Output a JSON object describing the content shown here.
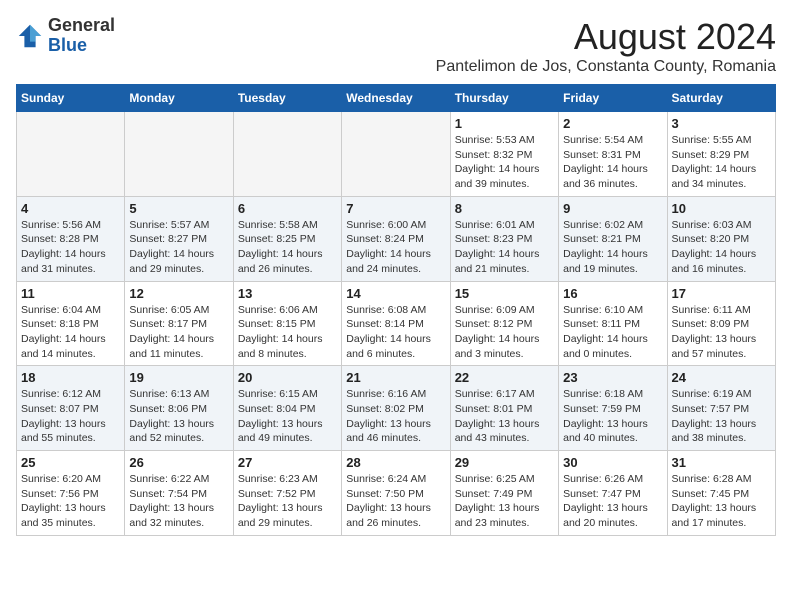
{
  "header": {
    "logo_general": "General",
    "logo_blue": "Blue",
    "month_year": "August 2024",
    "location": "Pantelimon de Jos, Constanta County, Romania"
  },
  "days_of_week": [
    "Sunday",
    "Monday",
    "Tuesday",
    "Wednesday",
    "Thursday",
    "Friday",
    "Saturday"
  ],
  "weeks": [
    {
      "alt": false,
      "days": [
        {
          "num": "",
          "info": ""
        },
        {
          "num": "",
          "info": ""
        },
        {
          "num": "",
          "info": ""
        },
        {
          "num": "",
          "info": ""
        },
        {
          "num": "1",
          "info": "Sunrise: 5:53 AM\nSunset: 8:32 PM\nDaylight: 14 hours\nand 39 minutes."
        },
        {
          "num": "2",
          "info": "Sunrise: 5:54 AM\nSunset: 8:31 PM\nDaylight: 14 hours\nand 36 minutes."
        },
        {
          "num": "3",
          "info": "Sunrise: 5:55 AM\nSunset: 8:29 PM\nDaylight: 14 hours\nand 34 minutes."
        }
      ]
    },
    {
      "alt": true,
      "days": [
        {
          "num": "4",
          "info": "Sunrise: 5:56 AM\nSunset: 8:28 PM\nDaylight: 14 hours\nand 31 minutes."
        },
        {
          "num": "5",
          "info": "Sunrise: 5:57 AM\nSunset: 8:27 PM\nDaylight: 14 hours\nand 29 minutes."
        },
        {
          "num": "6",
          "info": "Sunrise: 5:58 AM\nSunset: 8:25 PM\nDaylight: 14 hours\nand 26 minutes."
        },
        {
          "num": "7",
          "info": "Sunrise: 6:00 AM\nSunset: 8:24 PM\nDaylight: 14 hours\nand 24 minutes."
        },
        {
          "num": "8",
          "info": "Sunrise: 6:01 AM\nSunset: 8:23 PM\nDaylight: 14 hours\nand 21 minutes."
        },
        {
          "num": "9",
          "info": "Sunrise: 6:02 AM\nSunset: 8:21 PM\nDaylight: 14 hours\nand 19 minutes."
        },
        {
          "num": "10",
          "info": "Sunrise: 6:03 AM\nSunset: 8:20 PM\nDaylight: 14 hours\nand 16 minutes."
        }
      ]
    },
    {
      "alt": false,
      "days": [
        {
          "num": "11",
          "info": "Sunrise: 6:04 AM\nSunset: 8:18 PM\nDaylight: 14 hours\nand 14 minutes."
        },
        {
          "num": "12",
          "info": "Sunrise: 6:05 AM\nSunset: 8:17 PM\nDaylight: 14 hours\nand 11 minutes."
        },
        {
          "num": "13",
          "info": "Sunrise: 6:06 AM\nSunset: 8:15 PM\nDaylight: 14 hours\nand 8 minutes."
        },
        {
          "num": "14",
          "info": "Sunrise: 6:08 AM\nSunset: 8:14 PM\nDaylight: 14 hours\nand 6 minutes."
        },
        {
          "num": "15",
          "info": "Sunrise: 6:09 AM\nSunset: 8:12 PM\nDaylight: 14 hours\nand 3 minutes."
        },
        {
          "num": "16",
          "info": "Sunrise: 6:10 AM\nSunset: 8:11 PM\nDaylight: 14 hours\nand 0 minutes."
        },
        {
          "num": "17",
          "info": "Sunrise: 6:11 AM\nSunset: 8:09 PM\nDaylight: 13 hours\nand 57 minutes."
        }
      ]
    },
    {
      "alt": true,
      "days": [
        {
          "num": "18",
          "info": "Sunrise: 6:12 AM\nSunset: 8:07 PM\nDaylight: 13 hours\nand 55 minutes."
        },
        {
          "num": "19",
          "info": "Sunrise: 6:13 AM\nSunset: 8:06 PM\nDaylight: 13 hours\nand 52 minutes."
        },
        {
          "num": "20",
          "info": "Sunrise: 6:15 AM\nSunset: 8:04 PM\nDaylight: 13 hours\nand 49 minutes."
        },
        {
          "num": "21",
          "info": "Sunrise: 6:16 AM\nSunset: 8:02 PM\nDaylight: 13 hours\nand 46 minutes."
        },
        {
          "num": "22",
          "info": "Sunrise: 6:17 AM\nSunset: 8:01 PM\nDaylight: 13 hours\nand 43 minutes."
        },
        {
          "num": "23",
          "info": "Sunrise: 6:18 AM\nSunset: 7:59 PM\nDaylight: 13 hours\nand 40 minutes."
        },
        {
          "num": "24",
          "info": "Sunrise: 6:19 AM\nSunset: 7:57 PM\nDaylight: 13 hours\nand 38 minutes."
        }
      ]
    },
    {
      "alt": false,
      "days": [
        {
          "num": "25",
          "info": "Sunrise: 6:20 AM\nSunset: 7:56 PM\nDaylight: 13 hours\nand 35 minutes."
        },
        {
          "num": "26",
          "info": "Sunrise: 6:22 AM\nSunset: 7:54 PM\nDaylight: 13 hours\nand 32 minutes."
        },
        {
          "num": "27",
          "info": "Sunrise: 6:23 AM\nSunset: 7:52 PM\nDaylight: 13 hours\nand 29 minutes."
        },
        {
          "num": "28",
          "info": "Sunrise: 6:24 AM\nSunset: 7:50 PM\nDaylight: 13 hours\nand 26 minutes."
        },
        {
          "num": "29",
          "info": "Sunrise: 6:25 AM\nSunset: 7:49 PM\nDaylight: 13 hours\nand 23 minutes."
        },
        {
          "num": "30",
          "info": "Sunrise: 6:26 AM\nSunset: 7:47 PM\nDaylight: 13 hours\nand 20 minutes."
        },
        {
          "num": "31",
          "info": "Sunrise: 6:28 AM\nSunset: 7:45 PM\nDaylight: 13 hours\nand 17 minutes."
        }
      ]
    }
  ]
}
